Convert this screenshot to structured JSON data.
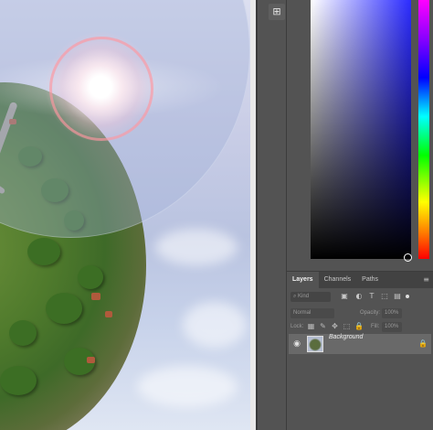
{
  "canvas": {
    "description_colors": {
      "sky": "#c9cde6",
      "bubble": "#a0afd7",
      "glow_ring": "#ff96a0"
    }
  },
  "toolstrip": {
    "collapse_icon": "collapse-panels-icon"
  },
  "layers_panel": {
    "tabs": [
      "Layers",
      "Channels",
      "Paths"
    ],
    "menu_icon": "panel-menu-icon",
    "filter": {
      "kind_label": "Kind",
      "icons": [
        "image-filter-icon",
        "adjustment-filter-icon",
        "type-filter-icon",
        "shape-filter-icon",
        "smart-object-filter-icon"
      ]
    },
    "blend": {
      "mode": "Normal",
      "opacity_label": "Opacity:",
      "opacity_value": "100%"
    },
    "lock": {
      "label": "Lock:",
      "fill_label": "Fill:",
      "fill_value": "100%"
    },
    "layers": [
      {
        "name": "Background",
        "visible": true,
        "locked": true
      }
    ]
  },
  "color_panel": {
    "hue_selected": "#2b2bff"
  }
}
